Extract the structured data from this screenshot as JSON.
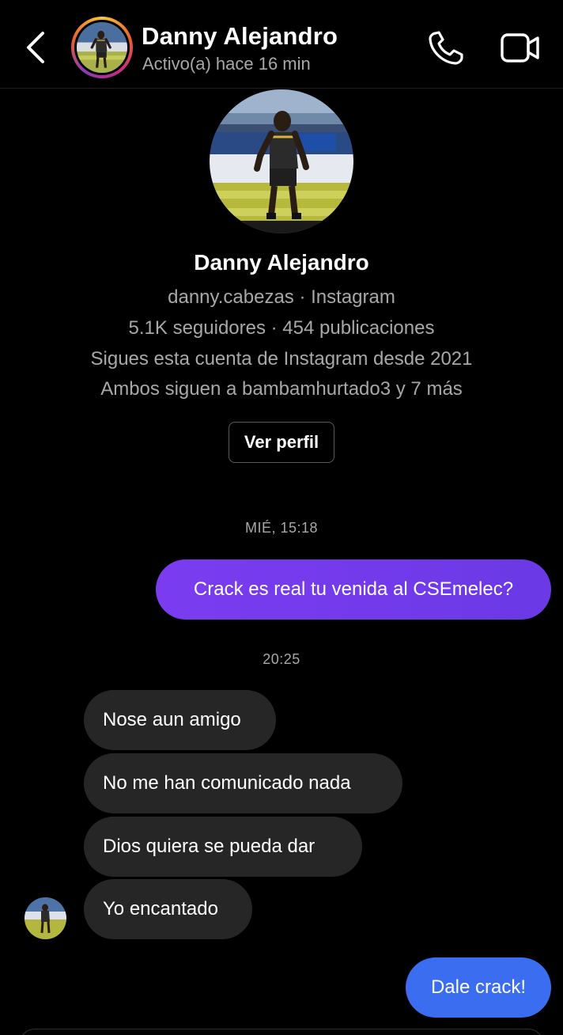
{
  "header": {
    "name": "Danny Alejandro",
    "status": "Activo(a) hace 16 min"
  },
  "profile": {
    "name": "Danny Alejandro",
    "handle_line": "danny.cabezas · Instagram",
    "stats_line": "5.1K seguidores · 454 publicaciones",
    "follow_since": "Sigues esta cuenta de Instagram desde 2021",
    "mutuals": "Ambos siguen a bambamhurtado3 y 7 más",
    "view_profile_label": "Ver perfil"
  },
  "thread": {
    "timestamp_1": "MIÉ, 15:18",
    "timestamp_2": "20:25",
    "outgoing_1": "Crack es real tu venida al CSEmelec?",
    "incoming": [
      "Nose aun amigo",
      "No me han comunicado nada",
      "Dios quiera se pueda dar",
      "Yo encantado"
    ],
    "outgoing_2": "Dale crack!"
  },
  "colors": {
    "background": "#000000",
    "outgoing_purple": "#7b3cf0",
    "outgoing_blue": "#3b6df0",
    "incoming_bubble": "#262626",
    "secondary_text": "#a8a8a8"
  },
  "icons": {
    "back": "chevron-left-icon",
    "call": "phone-icon",
    "video": "video-camera-icon"
  }
}
